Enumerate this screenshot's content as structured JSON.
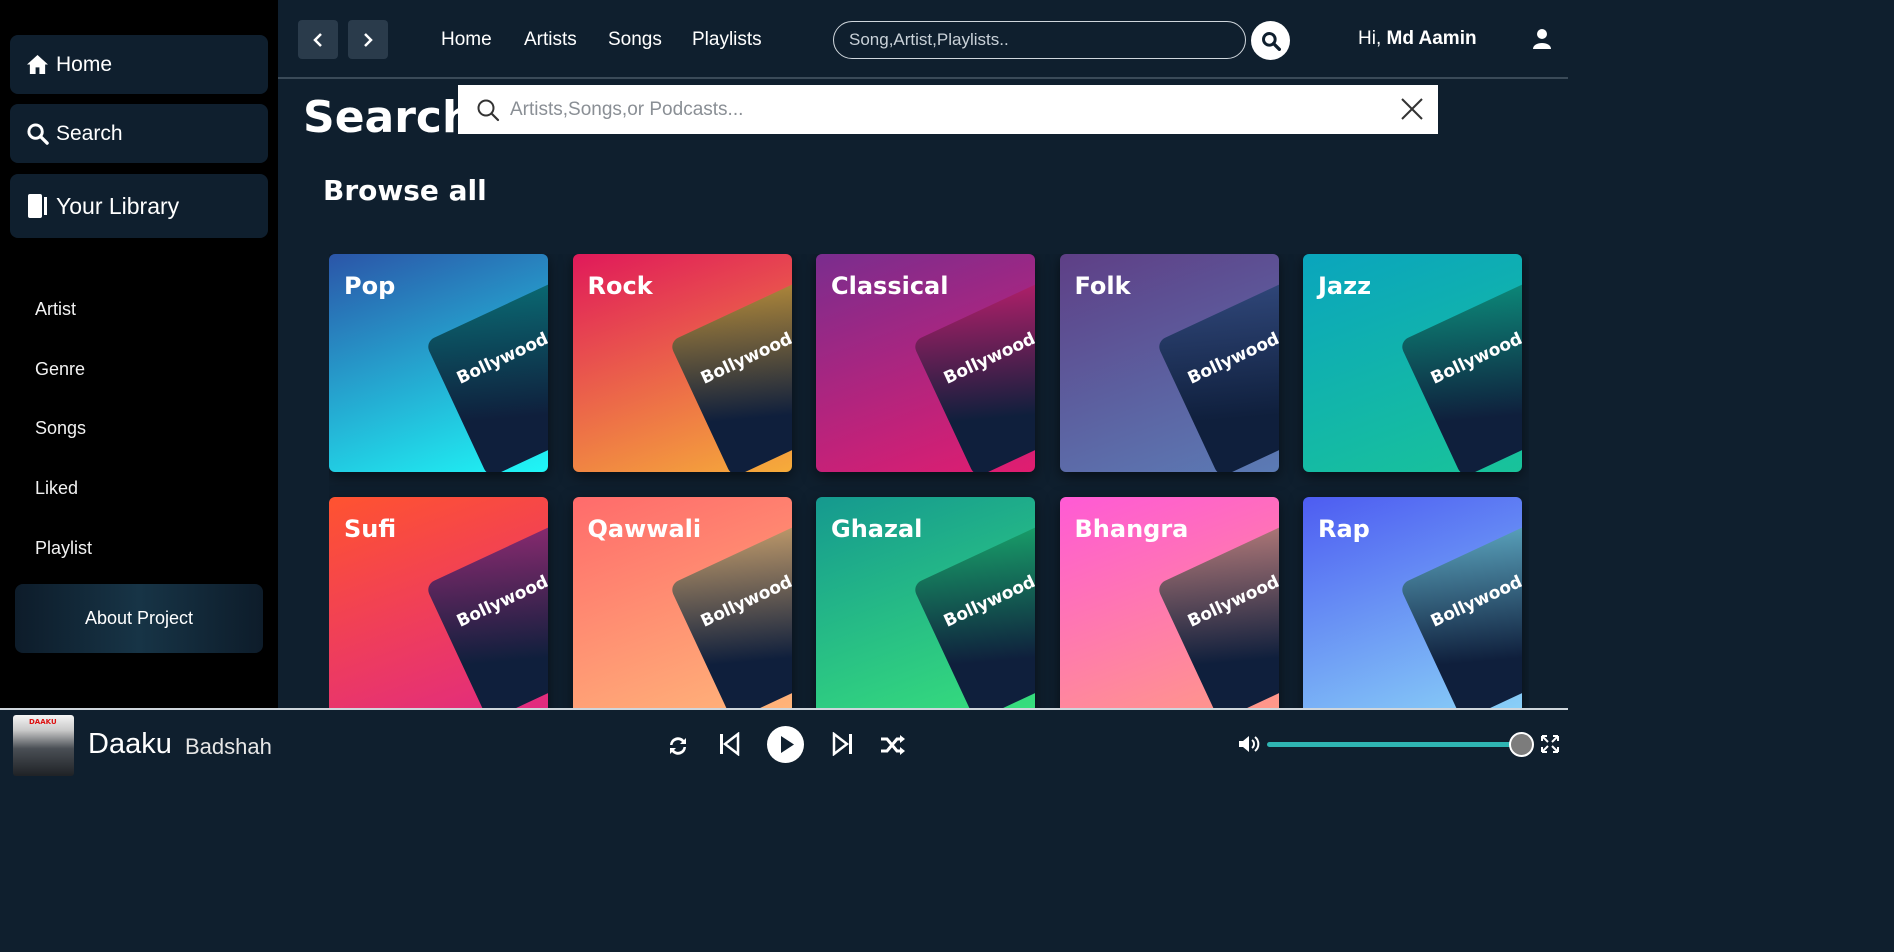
{
  "sidebar": {
    "main": [
      {
        "label": "Home",
        "icon": "home-icon"
      },
      {
        "label": "Search",
        "icon": "search-icon"
      },
      {
        "label": "Your Library",
        "icon": "library-icon"
      }
    ],
    "links": [
      "Artist",
      "Genre",
      "Songs",
      "Liked",
      "Playlist"
    ],
    "about_label": "About Project"
  },
  "topnav": {
    "links": [
      "Home",
      "Artists",
      "Songs",
      "Playlists"
    ],
    "search_placeholder": "Song,Artist,Playlists..",
    "greeting": "Hi,",
    "username": "Md Aamin"
  },
  "search": {
    "title": "Search",
    "placeholder": "Artists,Songs,or Podcasts..."
  },
  "browse": {
    "title": "Browse all",
    "tile_label": "Bollywood",
    "genres": [
      {
        "name": "Pop",
        "bg": [
          "#2b55a8",
          "#1ff7f7"
        ],
        "tile": [
          "#0f1f3c",
          "#0a6a73"
        ]
      },
      {
        "name": "Rock",
        "bg": [
          "#e0195a",
          "#f6ac3a"
        ],
        "tile": [
          "#0f1f3c",
          "#b0883a"
        ]
      },
      {
        "name": "Classical",
        "bg": [
          "#7a2d8e",
          "#e11d70"
        ],
        "tile": [
          "#0f1f3c",
          "#b21f6a"
        ]
      },
      {
        "name": "Folk",
        "bg": [
          "#5e3f86",
          "#5b7bb5"
        ],
        "tile": [
          "#0f1f3c",
          "#30477a"
        ]
      },
      {
        "name": "Jazz",
        "bg": [
          "#0aa5bd",
          "#19c39a"
        ],
        "tile": [
          "#0f1f3c",
          "#0c8a7a"
        ]
      },
      {
        "name": "Sufi",
        "bg": [
          "#ff5330",
          "#e02a82"
        ],
        "tile": [
          "#0f1f3c",
          "#8a2a70"
        ]
      },
      {
        "name": "Qawwali",
        "bg": [
          "#ff6b6b",
          "#ffb67a"
        ],
        "tile": [
          "#0f1f3c",
          "#c09a6a"
        ]
      },
      {
        "name": "Ghazal",
        "bg": [
          "#15998f",
          "#38e07c"
        ],
        "tile": [
          "#0f1f3c",
          "#18a06a"
        ]
      },
      {
        "name": "Bhangra",
        "bg": [
          "#ff5ad5",
          "#ff9a86"
        ],
        "tile": [
          "#0f1f3c",
          "#b07878"
        ]
      },
      {
        "name": "Rap",
        "bg": [
          "#4d5cf2",
          "#8ad2f7"
        ],
        "tile": [
          "#0f1f3c",
          "#5aa3bd"
        ]
      }
    ]
  },
  "player": {
    "cover_text": "DAAKU",
    "title": "Daaku",
    "artist": "Badshah",
    "volume": 0.97
  }
}
